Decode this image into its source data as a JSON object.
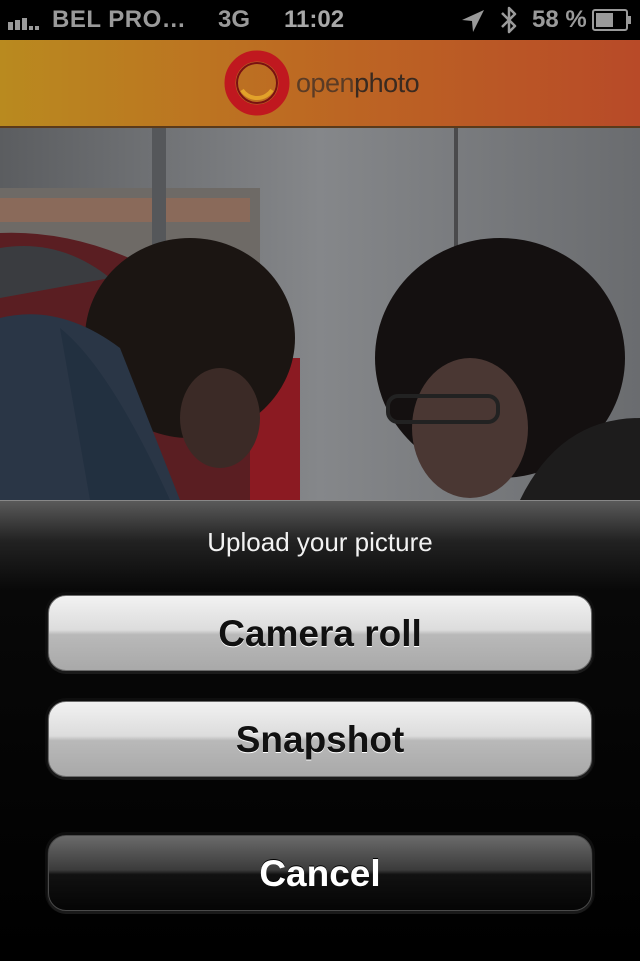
{
  "status_bar": {
    "carrier": "BEL PRO…",
    "network": "3G",
    "time": "11:02",
    "battery": "58 %",
    "icons": [
      "signal-bars-icon",
      "location-arrow-icon",
      "bluetooth-icon",
      "battery-icon"
    ]
  },
  "header": {
    "logo_text_open": "open",
    "logo_text_photo": "photo",
    "logo_ring_color": "#c0181f",
    "logo_inner_color": "#e2a22a"
  },
  "photo": {
    "description_icon": "photo-preview"
  },
  "action_sheet": {
    "title": "Upload your picture",
    "buttons": {
      "camera_roll": "Camera roll",
      "snapshot": "Snapshot",
      "cancel": "Cancel"
    }
  },
  "colors": {
    "header_left": "#b98a1f",
    "header_right": "#b84a28",
    "sheet_bg": "#000000"
  }
}
